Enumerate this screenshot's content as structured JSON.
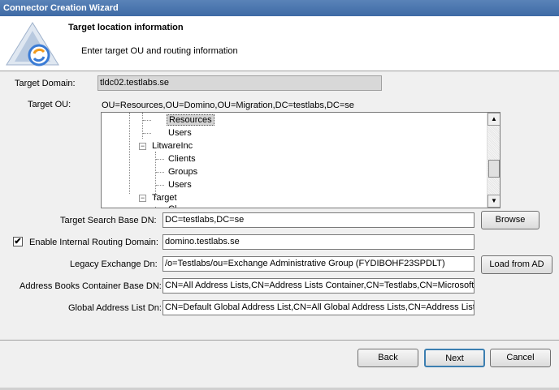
{
  "window": {
    "title": "Connector Creation Wizard"
  },
  "header": {
    "title": "Target location information",
    "subtitle": "Enter target OU and routing information",
    "logo": "wizard-logo"
  },
  "form": {
    "target_domain_label": "Target Domain:",
    "target_domain_value": "tldc02.testlabs.se",
    "target_ou_label": "Target OU:",
    "target_ou_value": "OU=Resources,OU=Domino,OU=Migration,DC=testlabs,DC=se",
    "search_base_label": "Target Search Base DN:",
    "search_base_value": "DC=testlabs,DC=se",
    "browse_label": "Browse",
    "routing_checkbox_checked": true,
    "routing_label": "Enable Internal Routing Domain:",
    "routing_value": "domino.testlabs.se",
    "legacy_label": "Legacy Exchange Dn:",
    "legacy_value": "/o=Testlabs/ou=Exchange Administrative Group (FYDIBOHF23SPDLT)",
    "load_ad_label": "Load from AD",
    "address_books_label": "Address Books Container Base DN:",
    "address_books_value": "CN=All Address Lists,CN=Address Lists Container,CN=Testlabs,CN=Microsoft Exchange",
    "gal_label": "Global Address List Dn:",
    "gal_value": "CN=Default Global Address List,CN=All Global Address Lists,CN=Address Lists Container"
  },
  "tree": {
    "items": [
      {
        "label": "Resources",
        "selected": true
      },
      {
        "label": "Users"
      },
      {
        "label": "LitwareInc",
        "expander": "−"
      },
      {
        "label": "Clients"
      },
      {
        "label": "Groups"
      },
      {
        "label": "Users"
      },
      {
        "label": "Target",
        "expander": "−"
      },
      {
        "label": "Cl"
      }
    ],
    "scroll_up": "▲",
    "scroll_down": "▼"
  },
  "footer": {
    "back_label": "Back",
    "next_label": "Next",
    "cancel_label": "Cancel"
  },
  "checkmark": "✔"
}
